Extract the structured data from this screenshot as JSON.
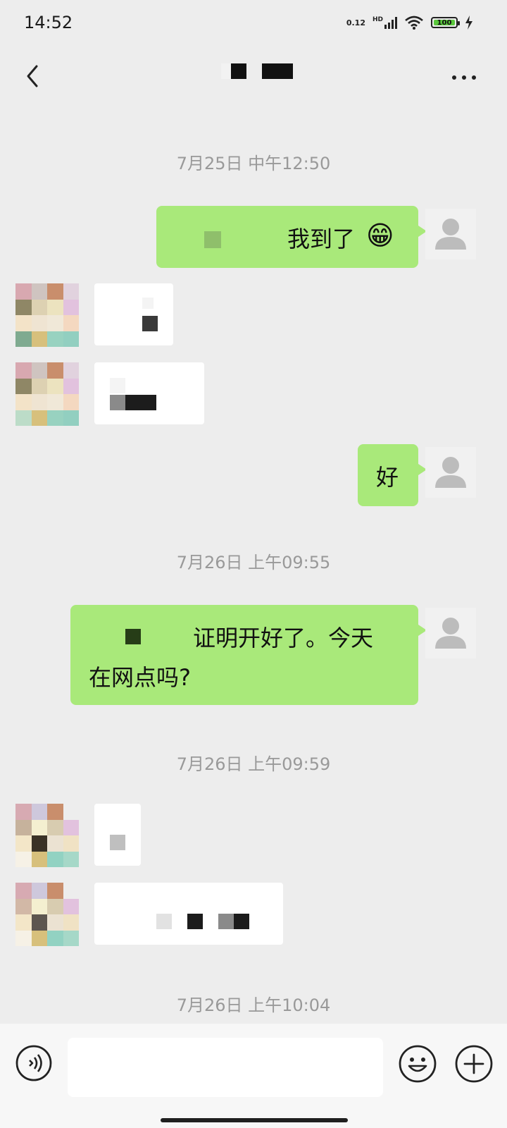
{
  "status_bar": {
    "time": "14:52",
    "net_speed": "0.12",
    "network_type": "HD",
    "battery_level": "100",
    "icons": [
      "signal-icon",
      "wifi-icon",
      "battery-icon",
      "charging-icon"
    ]
  },
  "header": {
    "back_icon": "chevron-left-icon",
    "more_icon": "more-dots-icon"
  },
  "timestamps": {
    "t1": "7月25日 中午12:50",
    "t2": "7月26日 上午09:55",
    "t3": "7月26日 上午09:59",
    "t4": "7月26日 上午10:04"
  },
  "messages": [
    {
      "direction": "outgoing",
      "text": "我到了",
      "emoji": "😁"
    },
    {
      "direction": "incoming",
      "text": ""
    },
    {
      "direction": "incoming",
      "text": ""
    },
    {
      "direction": "outgoing",
      "text": "好"
    },
    {
      "direction": "outgoing",
      "text_line1": "证明开好了。今天",
      "text_line2": "在网点吗?"
    },
    {
      "direction": "incoming",
      "text": ""
    },
    {
      "direction": "incoming",
      "text": ""
    }
  ],
  "input_bar": {
    "value": "",
    "voice_icon": "voice-icon",
    "emoji_icon": "emoji-icon",
    "plus_icon": "plus-icon"
  },
  "colors": {
    "background": "#ededed",
    "outgoing_bubble": "#a9e97a",
    "incoming_bubble": "#ffffff",
    "timestamp_text": "#999999"
  }
}
